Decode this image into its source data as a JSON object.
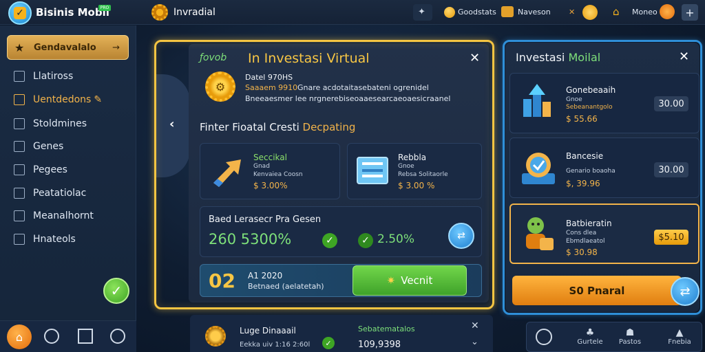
{
  "app": {
    "brand": "Bisinis Mobil",
    "badge": "PRO",
    "top_title": "Invradial"
  },
  "topbar": {
    "item1": "Goodstats",
    "item2": "Naveson",
    "item3": "Moneo"
  },
  "sidebar": {
    "active": {
      "label": "Gendavalalo",
      "icon": "star-icon"
    },
    "items": [
      {
        "label": "Llatiross",
        "icon": "chart-icon"
      },
      {
        "label": "Uentdedons",
        "icon": "pencil-icon"
      },
      {
        "label": "Stoldmines",
        "icon": "grid-icon"
      },
      {
        "label": "Genes",
        "icon": "gear-icon"
      },
      {
        "label": "Pegees",
        "icon": "page-icon"
      },
      {
        "label": "Peatatiolac",
        "icon": "info-icon"
      },
      {
        "label": "Meanalhornt",
        "icon": "shield-icon"
      },
      {
        "label": "Hnateols",
        "icon": "book-icon"
      }
    ]
  },
  "modal": {
    "title_prefix": "ƒovob",
    "title": "In Investasi Virtual",
    "info_line1": "Datel 970HS",
    "info_line2a": "Saaaem 9910",
    "info_line2b": "Gnare acdotaitasebateni ogrenidel",
    "info_line3": "Bneeaesmer lee nrgnerebiseoaaesearcaeoaesicraanel",
    "section_title_a": "Finter Fioatal Cresti",
    "section_title_b": "Decpating",
    "card_a": {
      "title": "Seccikal",
      "sub1": "Gnad",
      "sub2": "Kenvaiea Coosn",
      "value": "$ 3.00%"
    },
    "card_b": {
      "title": "Rebbla",
      "sub1": "Gnoe",
      "sub2": "Rebsa Solitaorle",
      "value": "$ 3.00 %"
    },
    "row": {
      "title": "Baed Lerasecr Pra Gesen",
      "big": "260 5300%",
      "pct": "2.50%"
    },
    "cta": {
      "number": "02",
      "line1": "A1 2020",
      "line2": "Betnaed (aelatetah)",
      "button": "Vecnit"
    }
  },
  "bottom_strip": {
    "title": "Luge Dinaaail",
    "sub": "Eekka uiv 1:16 2:60l",
    "title2": "Sebatematalos",
    "value2": "109,9398"
  },
  "rpanel": {
    "title_a": "Investasi",
    "title_b": "Moilal",
    "cards": [
      {
        "name": "Gonebeaaih",
        "sub1": "Gnoe",
        "sub2": "Sebeanantgolo",
        "value": "$ 55.66",
        "badge": "30.00",
        "icon": "building-chart-icon"
      },
      {
        "name": "Bancesie",
        "sub1": "Genario boaoha",
        "sub2": "",
        "value": "$, 39.96",
        "badge": "30.00",
        "icon": "badge-icon"
      },
      {
        "name": "Batbieratin",
        "sub1": "Cons dlea",
        "sub2": "Ebmdlaeatol",
        "value": "$ 30.98",
        "badge": "$5.10",
        "icon": "character-icon"
      }
    ],
    "button": "S0 Pnaral",
    "bottom_labels": [
      "Gurtele",
      "Pastos",
      "Fnebia"
    ]
  },
  "colors": {
    "accent_gold": "#f3b44a",
    "accent_green": "#7ee07a",
    "accent_blue": "#2f8fd8"
  }
}
